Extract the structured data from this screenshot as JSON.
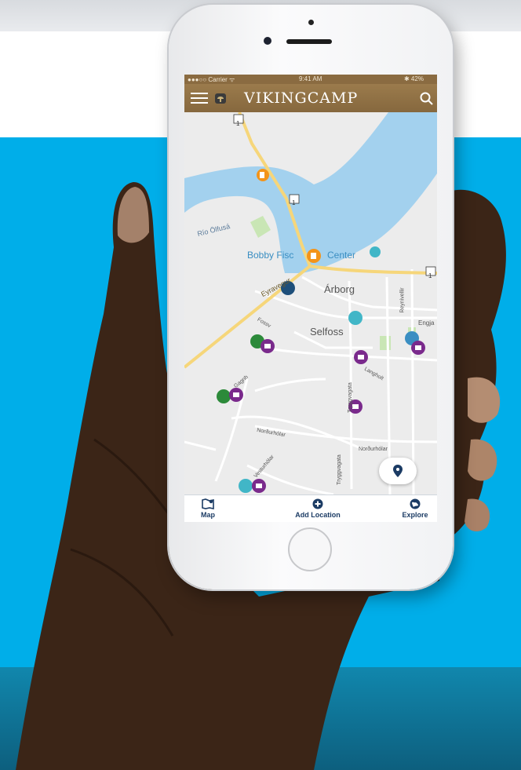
{
  "status_bar": {
    "carrier": "●●●○○ Carrier ᯤ",
    "time": "9:41 AM",
    "battery": "✱ 42%"
  },
  "app_bar": {
    "title": "VIKINGCAMP",
    "menu_icon": "hamburger-menu-icon",
    "search_icon": "search-icon"
  },
  "map": {
    "labels": {
      "river": "Río Ölfusá",
      "place_1": "Bobby Fisc",
      "place_2": "Center",
      "town_1": "Árborg",
      "town_2": "Selfoss",
      "road_1": "Eyravegur",
      "road_2": "Reynivellir",
      "road_3": "Engja",
      "road_4": "Langholt",
      "road_5": "Norðurhólar",
      "road_6": "Tryggvagata",
      "road_7": "Norðurhólar",
      "road_8": "Vesturhólar",
      "road_9": "Tryggvagata",
      "road_10": "Fossv",
      "road_11": "Gagnh",
      "shield": "1"
    },
    "colors": {
      "water": "#a3d1ee",
      "road": "#f6d67a",
      "land": "#ececec",
      "park": "#c9e6b5"
    }
  },
  "tab_bar": {
    "tabs": [
      {
        "label": "Map",
        "icon": "map-icon"
      },
      {
        "label": "Add Location",
        "icon": "plus-circle-icon"
      },
      {
        "label": "Explore",
        "icon": "globe-icon"
      }
    ]
  },
  "colors": {
    "app_brown": "#8f7045",
    "tab_navy": "#1b3b64",
    "background_blue": "#00aee9"
  }
}
